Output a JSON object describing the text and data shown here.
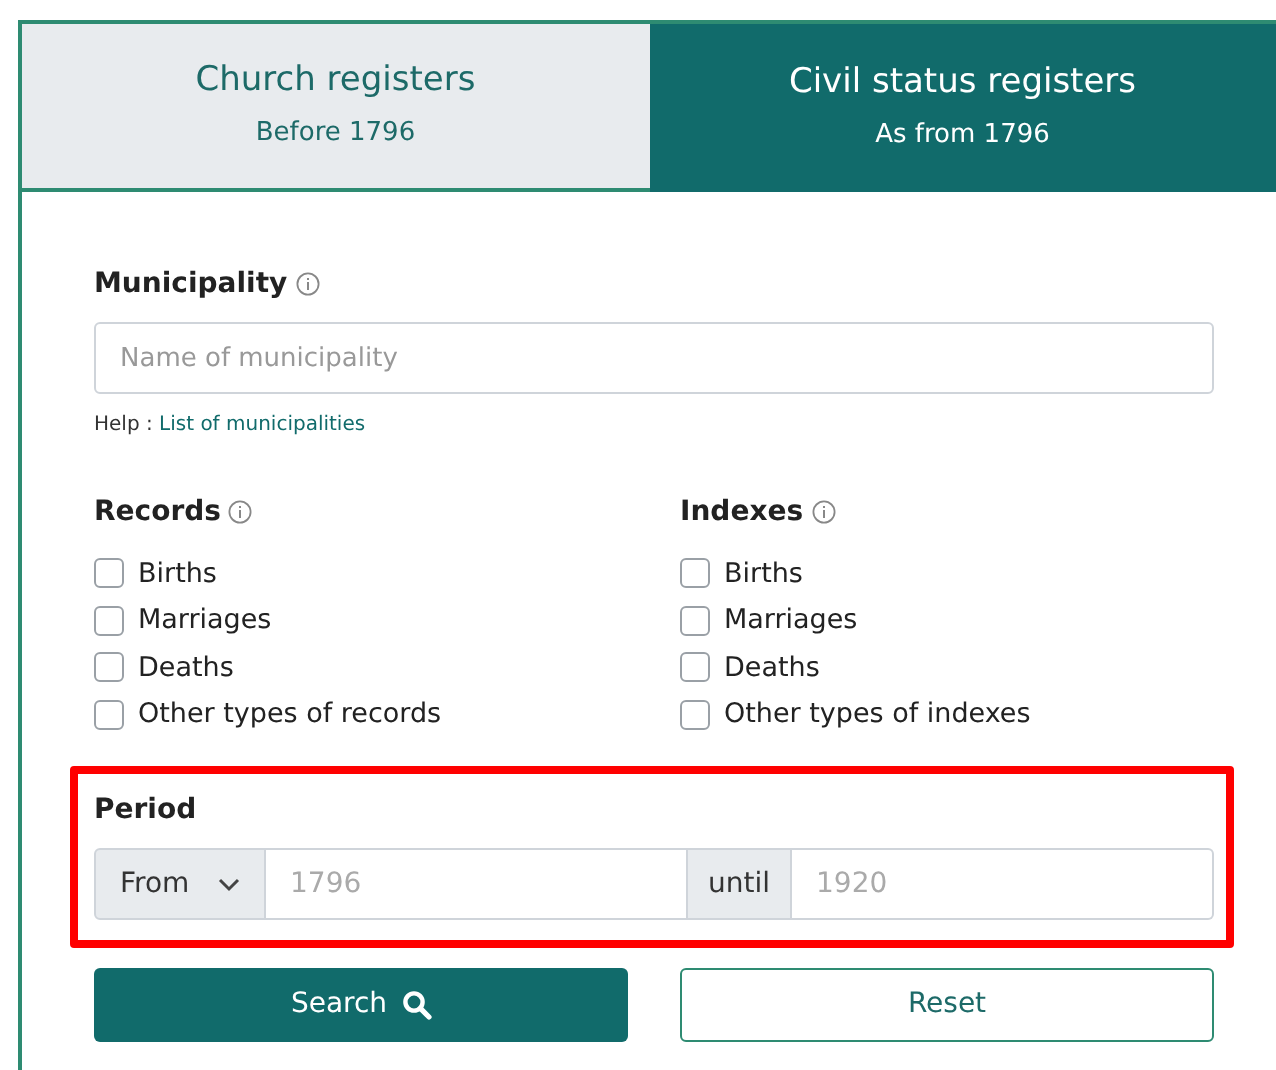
{
  "tabs": [
    {
      "title": "Church registers",
      "subtitle": "Before 1796",
      "selected": false
    },
    {
      "title": "Civil status registers",
      "subtitle": "As from 1796",
      "selected": true
    }
  ],
  "municipality": {
    "label": "Municipality",
    "placeholder": "Name of municipality",
    "help_label": "Help :",
    "help_link": "List of municipalities"
  },
  "groups": [
    {
      "label": "Records",
      "options": [
        {
          "label": "Births",
          "checked": false
        },
        {
          "label": "Marriages",
          "checked": false
        },
        {
          "label": "Deaths",
          "checked": false
        },
        {
          "label": "Other types of records",
          "checked": false
        }
      ]
    },
    {
      "label": "Indexes",
      "options": [
        {
          "label": "Births",
          "checked": false
        },
        {
          "label": "Marriages",
          "checked": false
        },
        {
          "label": "Deaths",
          "checked": false
        },
        {
          "label": "Other types of indexes",
          "checked": false
        }
      ]
    }
  ],
  "period": {
    "label": "Period",
    "mode": "From",
    "from_placeholder": "1796",
    "until_label": "until",
    "until_placeholder": "1920"
  },
  "buttons": [
    {
      "label": "Search",
      "kind": "primary"
    },
    {
      "label": "Reset",
      "kind": "secondary"
    }
  ]
}
